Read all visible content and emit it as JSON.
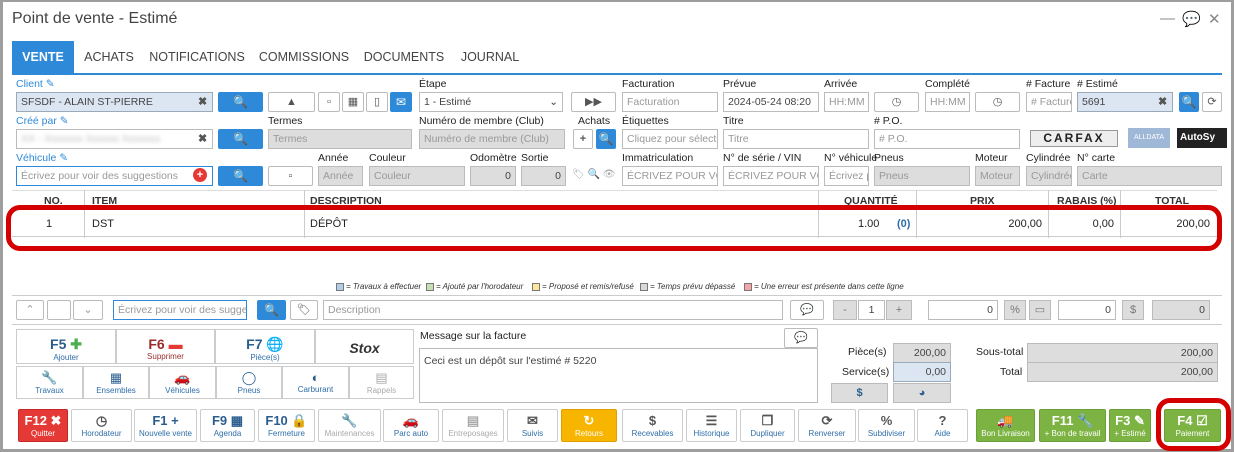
{
  "window": {
    "title": "Point de vente - Estimé",
    "icons": [
      "minimize-icon",
      "chat-icon",
      "close-icon"
    ]
  },
  "tabs": [
    "VENTE",
    "ACHATS",
    "NOTIFICATIONS",
    "COMMISSIONS",
    "DOCUMENTS",
    "JOURNAL"
  ],
  "client": {
    "label": "Client",
    "value": "SFSDF - ALAIN ST-PIERRE"
  },
  "cree_par": {
    "label": "Créé par",
    "value": "XX - Xxxxxxx Xxxxxx Xxxxxxx"
  },
  "vehicule": {
    "label": "Véhicule",
    "placeholder": "Écrivez pour voir des suggestions"
  },
  "etape": {
    "label": "Étape",
    "value": "1 - Estimé"
  },
  "termes": {
    "label": "Termes",
    "placeholder": "Termes"
  },
  "membre": {
    "label": "Numéro de membre (Club)",
    "placeholder": "Numéro de membre (Club)"
  },
  "achats": {
    "label": "Achats"
  },
  "annee": {
    "label": "Année",
    "placeholder": "Année"
  },
  "couleur": {
    "label": "Couleur",
    "placeholder": "Couleur"
  },
  "odometre": {
    "label": "Odomètre",
    "value": "0"
  },
  "sortie": {
    "label": "Sortie",
    "value": "0"
  },
  "facturation": {
    "label": "Facturation",
    "placeholder": "Facturation"
  },
  "prevue": {
    "label": "Prévue",
    "value": "2024-05-24 08:20"
  },
  "arrivee": {
    "label": "Arrivée",
    "placeholder": "HH:MM"
  },
  "complete": {
    "label": "Complété",
    "placeholder": "HH:MM"
  },
  "no_facture": {
    "label": "# Facture",
    "placeholder": "# Facture"
  },
  "no_estime": {
    "label": "# Estimé",
    "value": "5691"
  },
  "etiquettes": {
    "label": "Étiquettes",
    "placeholder": "Cliquez pour sélection"
  },
  "titre": {
    "label": "Titre",
    "placeholder": "Titre"
  },
  "po": {
    "label": "# P.O.",
    "placeholder": "# P.O."
  },
  "immatriculation": {
    "label": "Immatriculation",
    "placeholder": "ÉCRIVEZ POUR VOIR"
  },
  "serie": {
    "label": "N° de série / VIN",
    "placeholder": "ÉCRIVEZ POUR VOIR L"
  },
  "no_vehicule": {
    "label": "N° véhicule",
    "placeholder": "Écrivez p"
  },
  "pneus": {
    "label": "Pneus",
    "placeholder": "Pneus"
  },
  "moteur": {
    "label": "Moteur",
    "placeholder": "Moteur"
  },
  "cylindree": {
    "label": "Cylindrée",
    "placeholder": "Cylindrée"
  },
  "carte": {
    "label": "N° carte",
    "placeholder": "Carte"
  },
  "logos": {
    "carfax": "CARFAX",
    "alldata": "ALLDATA",
    "autosys": "AutoSy"
  },
  "table": {
    "headers": [
      "NO.",
      "ITEM",
      "DESCRIPTION",
      "QUANTITÉ",
      "PRIX",
      "RABAIS (%)",
      "TOTAL"
    ],
    "rows": [
      {
        "no": "1",
        "item": "DST",
        "description": "DÉPÔT",
        "quantite": "1.00",
        "qty_extra": "(0)",
        "prix": "200,00",
        "rabais": "0,00",
        "total": "200,00"
      }
    ]
  },
  "legend": [
    {
      "text": "= Travaux à effectuer",
      "color": "#b3cde8"
    },
    {
      "text": "= Ajouté par l'horodateur",
      "color": "#c5e0b4"
    },
    {
      "text": "= Proposé et remis/refusé",
      "color": "#ffe699"
    },
    {
      "text": "= Temps prévu dépassé",
      "color": "#d9d9d9"
    },
    {
      "text": "= Une erreur est présente dans cette ligne",
      "color": "#f4a6a6"
    }
  ],
  "entry": {
    "item_placeholder": "Écrivez pour voir des suggestio",
    "desc_placeholder": "Description",
    "qty": "1",
    "v1": "0",
    "v2": "0",
    "v3": "0",
    "minus": "-",
    "plus": "+",
    "pct": "%",
    "dollar": "$"
  },
  "fkeys": [
    {
      "key": "F5",
      "label": "Ajouter"
    },
    {
      "key": "F6",
      "label": "Supprimer"
    },
    {
      "key": "F7",
      "label": "Pièce(s)"
    },
    {
      "key": "Stox",
      "label": ""
    }
  ],
  "quick": [
    "Travaux",
    "Ensembles",
    "Véhicules",
    "Pneus",
    "Carburant",
    "Rappels"
  ],
  "message": {
    "label": "Message sur la facture",
    "text": "Ceci est un dépôt sur l'estimé # 5220"
  },
  "totals": {
    "pieces_label": "Pièce(s)",
    "pieces": "200,00",
    "service_label": "Service(s)",
    "service": "0,00",
    "sous_total_label": "Sous-total",
    "sous_total": "200,00",
    "total_label": "Total",
    "total": "200,00"
  },
  "toolbar": [
    {
      "icon": "F12 ✖",
      "label": "Quitter",
      "style": "red"
    },
    {
      "icon": "◷",
      "label": "Horodateur",
      "style": ""
    },
    {
      "icon": "F1 +",
      "label": "Nouvelle vente",
      "style": ""
    },
    {
      "icon": "F9 ▦",
      "label": "Agenda",
      "style": ""
    },
    {
      "icon": "F10 🔒",
      "label": "Fermeture",
      "style": ""
    },
    {
      "icon": "🔧",
      "label": "Maintenances",
      "style": "dis"
    },
    {
      "icon": "🚗",
      "label": "Parc auto",
      "style": ""
    },
    {
      "icon": "▤",
      "label": "Entreposages",
      "style": "dis"
    },
    {
      "icon": "✉",
      "label": "Suivis",
      "style": ""
    },
    {
      "icon": "↻",
      "label": "Retours",
      "style": "yel"
    },
    {
      "icon": "$",
      "label": "Recevables",
      "style": ""
    },
    {
      "icon": "☰",
      "label": "Historique",
      "style": ""
    },
    {
      "icon": "❐",
      "label": "Dupliquer",
      "style": ""
    },
    {
      "icon": "⟳",
      "label": "Renverser",
      "style": ""
    },
    {
      "icon": "%",
      "label": "Subdiviser",
      "style": ""
    },
    {
      "icon": "?",
      "label": "Aide",
      "style": ""
    },
    {
      "icon": "🚚",
      "label": "Bon Livraison",
      "style": "grn"
    },
    {
      "icon": "F11 🔧",
      "label": "+ Bon de travail",
      "style": "grn"
    },
    {
      "icon": "F3 ✎",
      "label": "+ Estimé",
      "style": "grn"
    },
    {
      "icon": "F4 ☑",
      "label": "Paiement",
      "style": "grn"
    }
  ]
}
